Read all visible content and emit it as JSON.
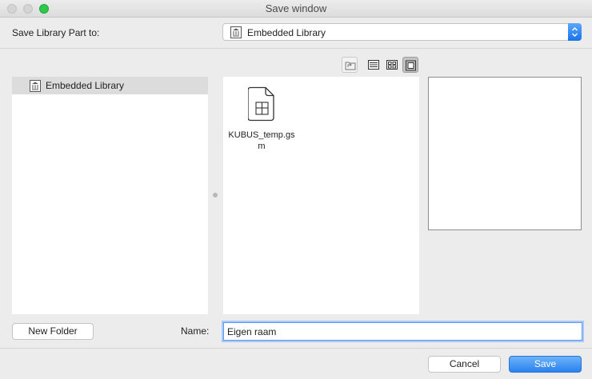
{
  "window": {
    "title": "Save window"
  },
  "save_to": {
    "label": "Save Library Part to:",
    "selected": "Embedded Library"
  },
  "library_tree": {
    "items": [
      {
        "label": "Embedded Library",
        "icon": "library-icon",
        "selected": true
      }
    ]
  },
  "view_toolbar": {
    "icons": [
      "folder-up-icon",
      "list-view-icon",
      "grid-view-icon",
      "preview-view-icon"
    ],
    "active": "preview-view-icon"
  },
  "files": [
    {
      "name": "KUBUS_temp.gsm",
      "icon": "gsm-file-icon"
    }
  ],
  "name_field": {
    "label": "Name:",
    "value": "Eigen raam"
  },
  "buttons": {
    "new_folder": "New Folder",
    "cancel": "Cancel",
    "save": "Save"
  },
  "colors": {
    "accent": "#2a82ee",
    "zoom": "#2ec94a"
  }
}
